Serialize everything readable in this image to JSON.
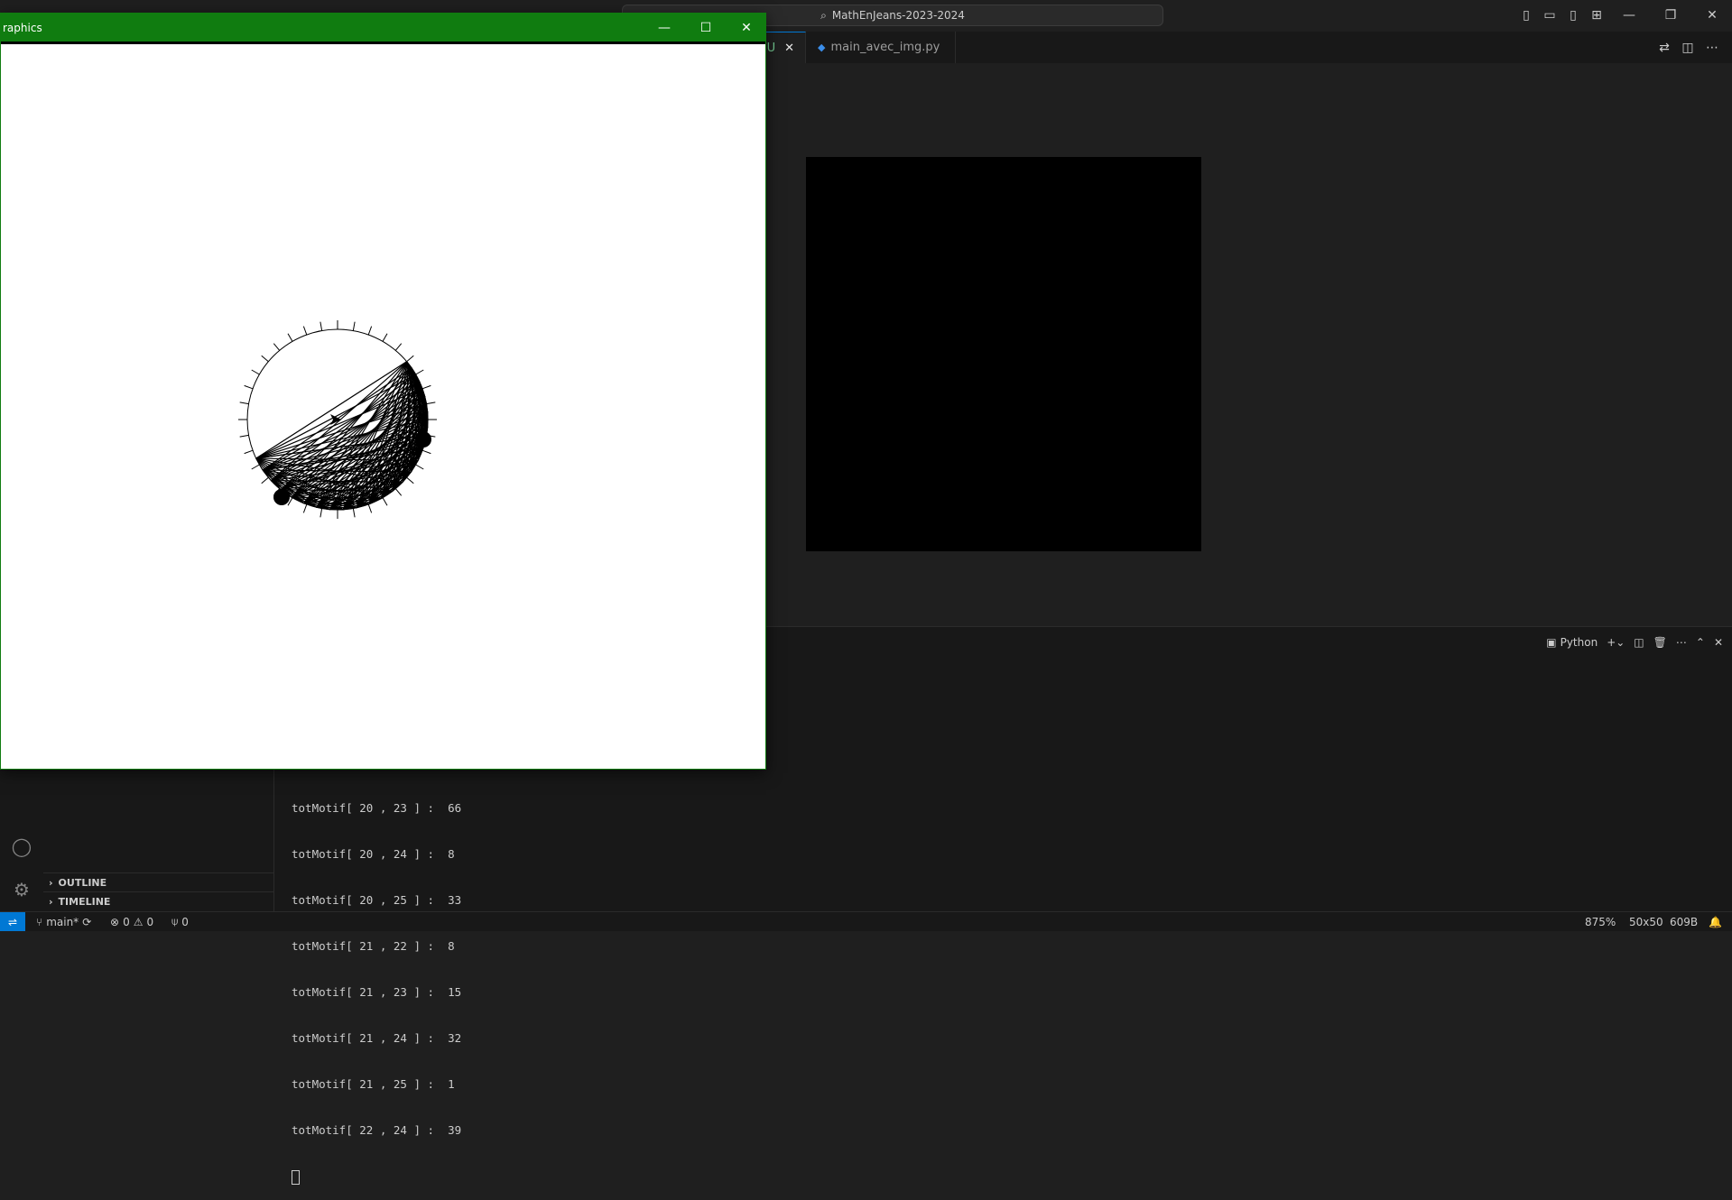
{
  "titlebar": {
    "search_text": "MathEnJeans-2023-2024"
  },
  "tabs": [
    {
      "label": "U",
      "active": true
    },
    {
      "label": "main_avec_img.py",
      "active": false
    }
  ],
  "graphics_window": {
    "title": "raphics"
  },
  "panel": {
    "terminal_profile": "Python"
  },
  "terminal_lines": [
    "totMotif[ 20 , 23 ] :  66",
    "totMotif[ 20 , 24 ] :  8",
    "totMotif[ 20 , 25 ] :  33",
    "totMotif[ 21 , 22 ] :  8",
    "totMotif[ 21 , 23 ] :  15",
    "totMotif[ 21 , 24 ] :  32",
    "totMotif[ 21 , 25 ] :  1",
    "totMotif[ 22 , 24 ] :  39"
  ],
  "sidebar": {
    "outline": "OUTLINE",
    "timeline": "TIMELINE"
  },
  "statusbar": {
    "branch": "main*",
    "errors": "0",
    "warnings": "0",
    "ports": "0",
    "zoom": "875%",
    "dimensions": "50x50",
    "size": "609B"
  },
  "colors": {
    "accent": "#0078d4",
    "window_title": "#107c10"
  }
}
